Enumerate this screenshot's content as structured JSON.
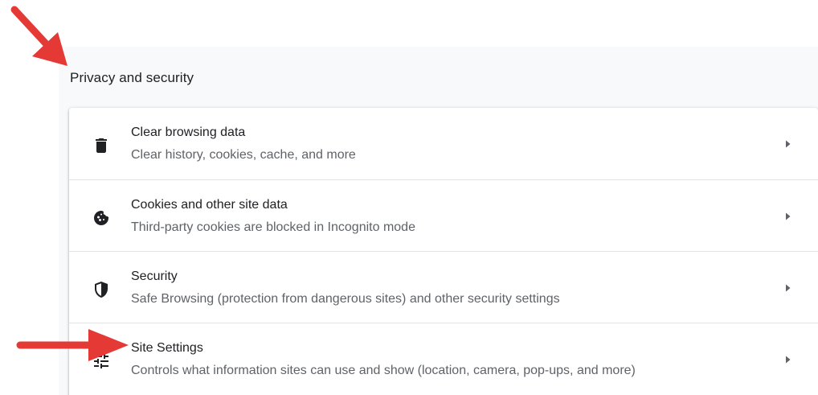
{
  "section": {
    "title": "Privacy and security"
  },
  "items": [
    {
      "title": "Clear browsing data",
      "subtitle": "Clear history, cookies, cache, and more",
      "icon": "trash-icon"
    },
    {
      "title": "Cookies and other site data",
      "subtitle": "Third-party cookies are blocked in Incognito mode",
      "icon": "cookie-icon"
    },
    {
      "title": "Security",
      "subtitle": "Safe Browsing (protection from dangerous sites) and other security settings",
      "icon": "shield-icon"
    },
    {
      "title": "Site Settings",
      "subtitle": "Controls what information sites can use and show (location, camera, pop-ups, and more)",
      "icon": "tune-icon"
    }
  ],
  "colors": {
    "annotation_arrow": "#e53935",
    "panel_background": "#f8f9fa",
    "icon": "#202124",
    "subtitle_text": "#5f6368"
  }
}
